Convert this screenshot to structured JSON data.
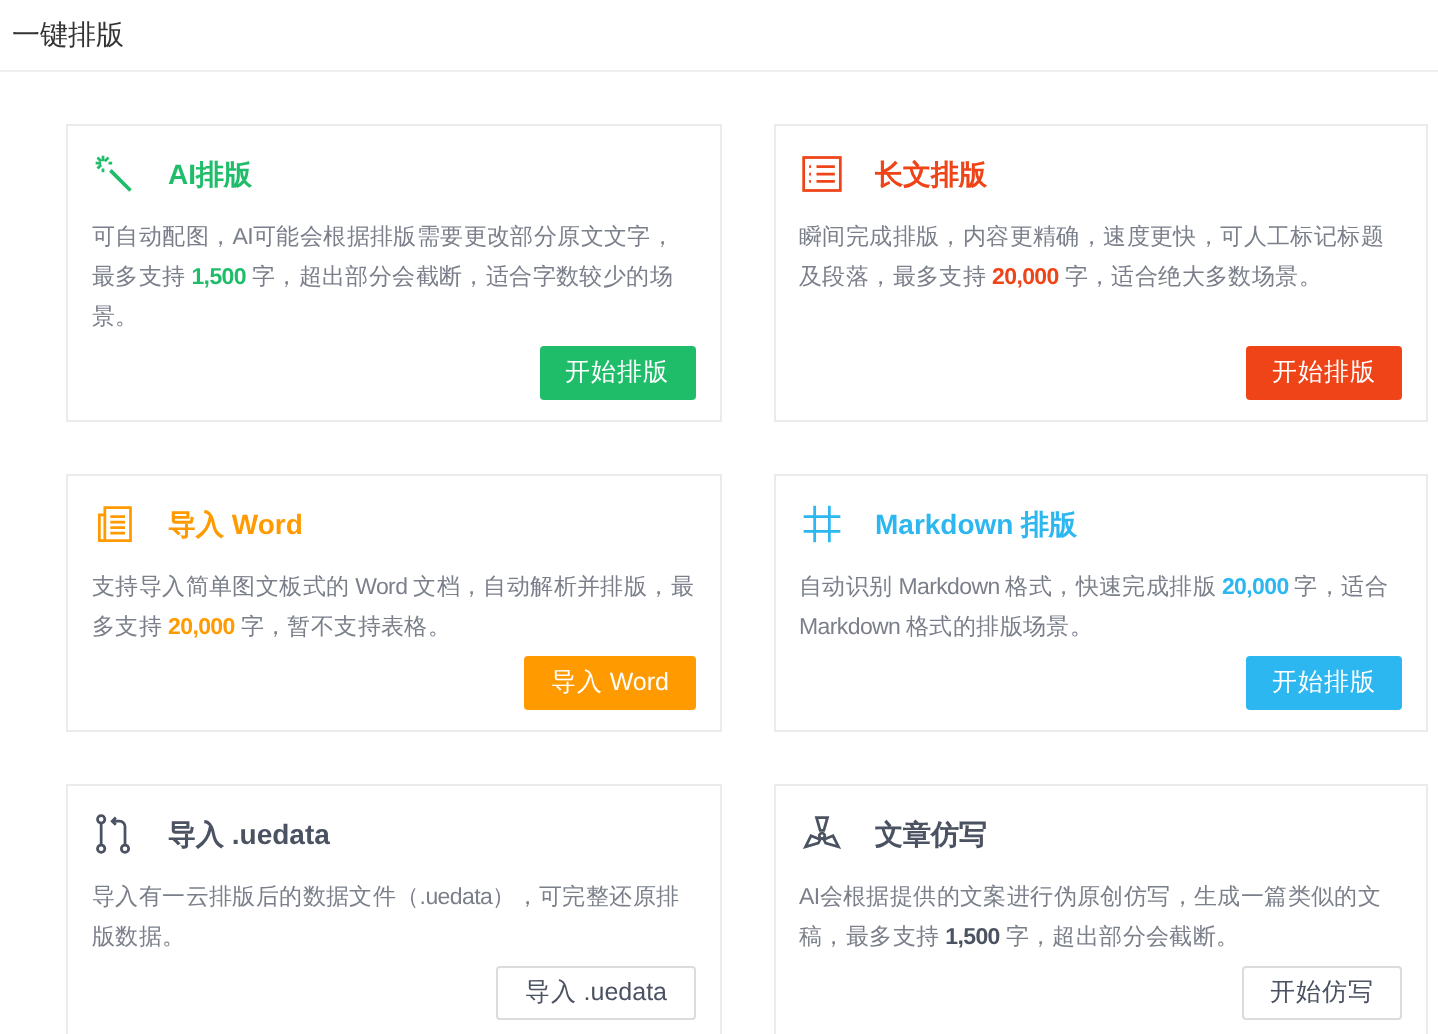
{
  "header": {
    "title": "一键排版"
  },
  "cards": [
    {
      "kind": "ai",
      "title": "AI排版",
      "color": "#1fbd6a",
      "description": "可自动配图，AI可能会根据排版需要更改部分原文文字，最多支持 **1,500** 字，超出部分会截断，适合字数较少的场景。",
      "button": {
        "label": "开始排版",
        "kind": "filled"
      }
    },
    {
      "kind": "long",
      "title": "长文排版",
      "color": "#ee4418",
      "description": "瞬间完成排版，内容更精确，速度更快，可人工标记标题及段落，最多支持 **20,000** 字，适合绝大多数场景。",
      "button": {
        "label": "开始排版",
        "kind": "filled"
      }
    },
    {
      "kind": "word",
      "title": "导入 Word",
      "color": "#ff9a00",
      "description": "支持导入简单图文板式的 Word 文档，自动解析并排版，最多支持 **20,000** 字，暂不支持表格。",
      "button": {
        "label": "导入 Word",
        "kind": "filled"
      }
    },
    {
      "kind": "markdown",
      "title": "Markdown 排版",
      "color": "#2db7f0",
      "description": "自动识别 Markdown 格式，快速完成排版 **20,000** 字，适合 Markdown 格式的排版场景。",
      "button": {
        "label": "开始排版",
        "kind": "filled"
      }
    },
    {
      "kind": "uedata",
      "title": "导入 .uedata",
      "color": "#4b5261",
      "description": "导入有一云排版后的数据文件（.uedata），可完整还原排版数据。",
      "button": {
        "label": "导入 .uedata",
        "kind": "outline"
      }
    },
    {
      "kind": "rewrite",
      "title": "文章仿写",
      "color": "#4b5261",
      "description": "AI会根据提供的文案进行伪原创仿写，生成一篇类似的文稿，最多支持 **1,500** 字，超出部分会截断。",
      "button": {
        "label": "开始仿写",
        "kind": "outline"
      }
    }
  ]
}
